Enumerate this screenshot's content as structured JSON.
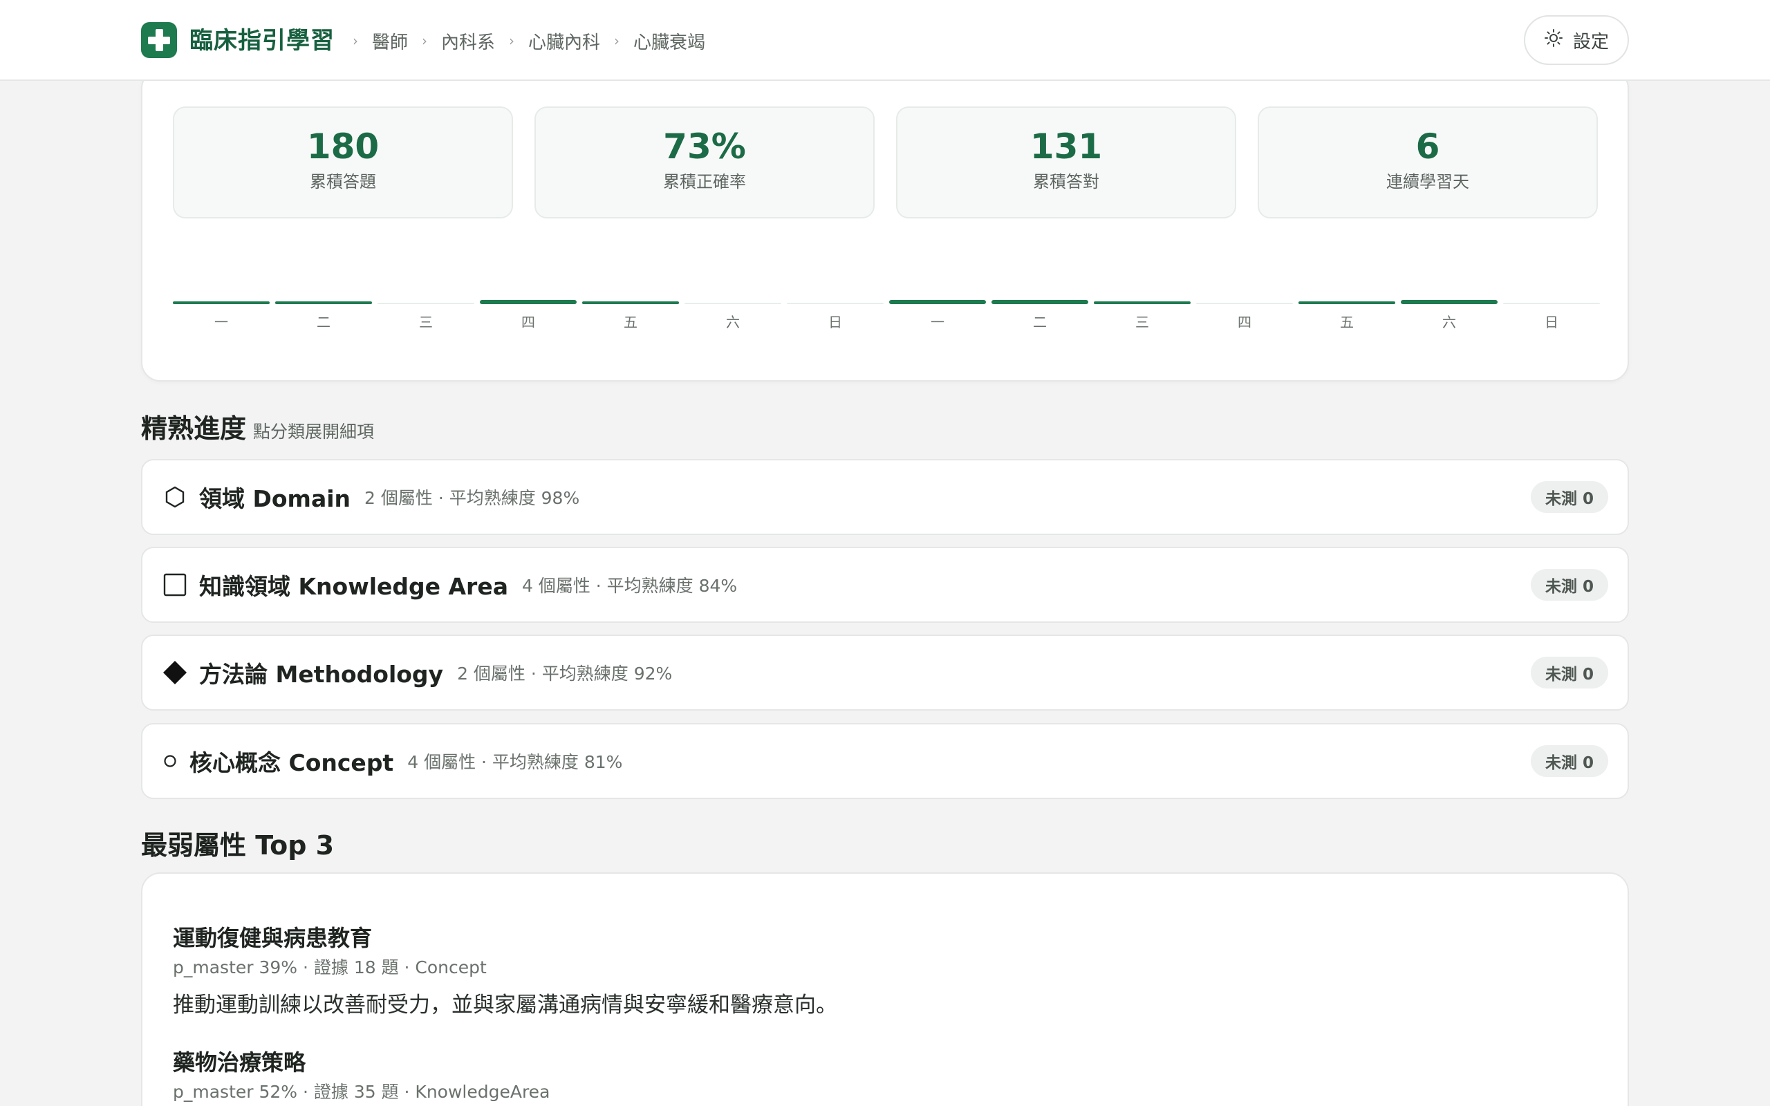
{
  "header": {
    "app_title": "臨床指引學習",
    "breadcrumbs": [
      "醫師",
      "內科系",
      "心臟內科",
      "心臟衰竭"
    ],
    "settings_label": "設定"
  },
  "stats": [
    {
      "value": "180",
      "label": "累積答題"
    },
    {
      "value": "73%",
      "label": "累積正確率"
    },
    {
      "value": "131",
      "label": "累積答對"
    },
    {
      "value": "6",
      "label": "連續學習天"
    }
  ],
  "chart_data": {
    "type": "bar",
    "categories": [
      "一",
      "二",
      "三",
      "四",
      "五",
      "六",
      "日",
      "一",
      "二",
      "三",
      "四",
      "五",
      "六",
      "日"
    ],
    "values": [
      2,
      2,
      1,
      3,
      2,
      1,
      1,
      3,
      3,
      2,
      1,
      2,
      3,
      1
    ],
    "colors": {
      "filled": "#1e7a4f",
      "empty": "#e6efea"
    }
  },
  "mastery": {
    "title": "精熟進度",
    "subtitle": "點分類展開細項",
    "rows": [
      {
        "icon": "hexagon-icon",
        "title": "領域 Domain",
        "meta": "2 個屬性 · 平均熟練度 98%",
        "badge": "未測 0"
      },
      {
        "icon": "square-icon",
        "title": "知識領域 Knowledge Area",
        "meta": "4 個屬性 · 平均熟練度 84%",
        "badge": "未測 0"
      },
      {
        "icon": "diamond-icon",
        "title": "方法論 Methodology",
        "meta": "2 個屬性 · 平均熟練度 92%",
        "badge": "未測 0"
      },
      {
        "icon": "circle-icon",
        "title": "核心概念 Concept",
        "meta": "4 個屬性 · 平均熟練度 81%",
        "badge": "未測 0"
      }
    ]
  },
  "weakest": {
    "title": "最弱屬性 Top 3",
    "items": [
      {
        "name": "運動復健與病患教育",
        "meta": "p_master 39% · 證據 18 題 · Concept",
        "desc": "推動運動訓練以改善耐受力，並與家屬溝通病情與安寧緩和醫療意向。"
      },
      {
        "name": "藥物治療策略",
        "meta": "p_master 52% · 證據 35 題 · KnowledgeArea"
      }
    ]
  },
  "colors": {
    "accent": "#1e7a4f",
    "accent_dark": "#17603f"
  }
}
